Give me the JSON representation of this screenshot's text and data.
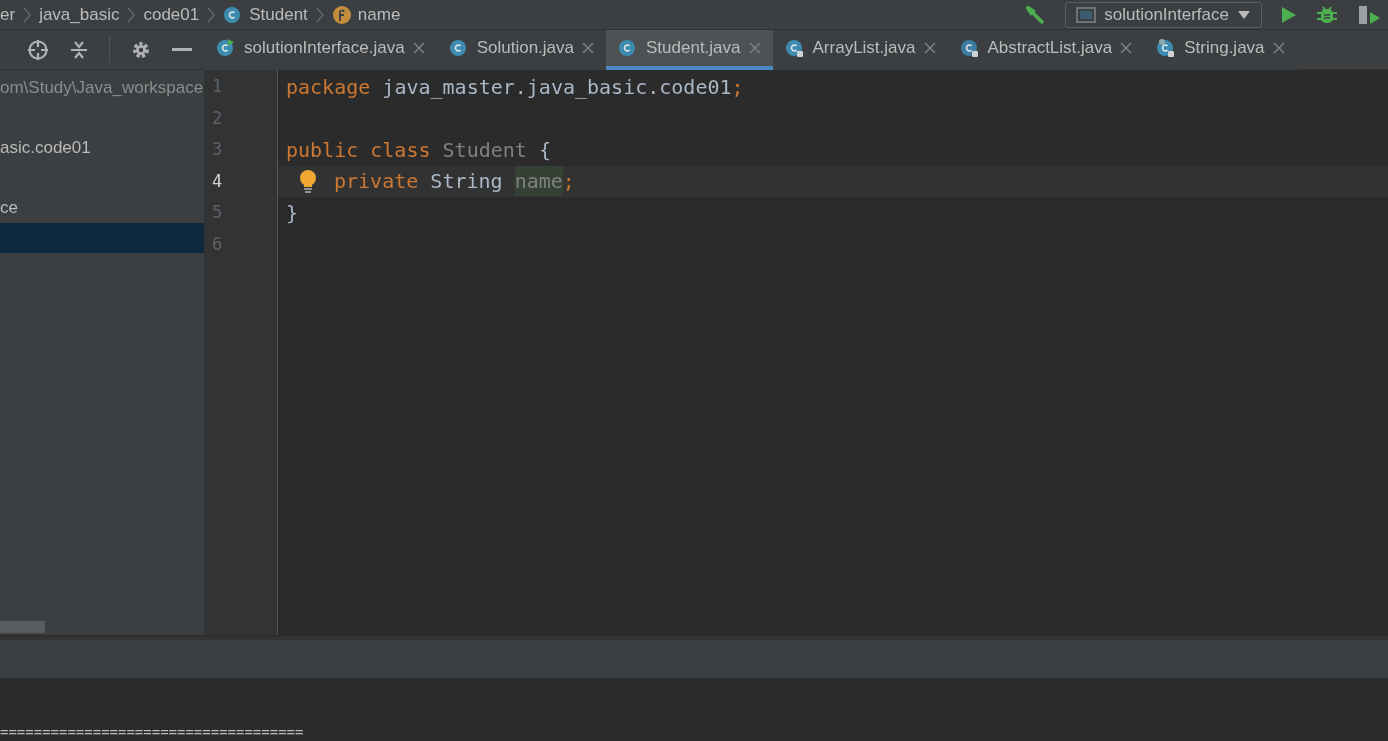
{
  "breadcrumbs": [
    {
      "label": "er",
      "kind": "folder"
    },
    {
      "label": "java_basic",
      "kind": "folder"
    },
    {
      "label": "code01",
      "kind": "folder"
    },
    {
      "label": "Student",
      "kind": "class"
    },
    {
      "label": "name",
      "kind": "field"
    }
  ],
  "run_config": {
    "label": "solutionInterface"
  },
  "tabs": [
    {
      "label": "solutionInterface.java",
      "kind": "runnable",
      "selected": false
    },
    {
      "label": "Solution.java",
      "kind": "class",
      "selected": false
    },
    {
      "label": "Student.java",
      "kind": "class",
      "selected": true
    },
    {
      "label": "ArrayList.java",
      "kind": "library",
      "selected": false
    },
    {
      "label": "AbstractList.java",
      "kind": "library-abstract",
      "selected": false
    },
    {
      "label": "String.java",
      "kind": "library-final",
      "selected": false
    }
  ],
  "project_tree": [
    {
      "label": "om\\Study\\Java_workspace",
      "muted": true,
      "selected": false
    },
    {
      "label": "asic.code01",
      "muted": false,
      "selected": false
    },
    {
      "label": "ce",
      "muted": false,
      "selected": false
    },
    {
      "selected": true
    }
  ],
  "editor": {
    "lines": [
      {
        "number": "1",
        "current": false,
        "tokens": [
          {
            "text": "package",
            "kind": "keyword"
          },
          {
            "text": " java_master.java_basic.code01",
            "kind": "plain"
          },
          {
            "text": ";",
            "kind": "keyword"
          }
        ]
      },
      {
        "number": "2",
        "current": false
      },
      {
        "number": "3",
        "current": false,
        "tokens": [
          {
            "text": "public class ",
            "kind": "keyword"
          },
          {
            "text": "Student",
            "kind": "muted"
          },
          {
            "text": " {",
            "kind": "plain"
          }
        ]
      },
      {
        "number": "4",
        "current": true,
        "bulb": true,
        "tokens": [
          {
            "text": "private",
            "kind": "keyword"
          },
          {
            "text": " String ",
            "kind": "plain"
          },
          {
            "text": "name",
            "kind": "highlight"
          },
          {
            "text": ";",
            "kind": "keyword"
          }
        ]
      },
      {
        "number": "5",
        "current": false,
        "tokens": [
          {
            "text": "}",
            "kind": "plain"
          }
        ]
      },
      {
        "number": "6",
        "current": false
      }
    ]
  },
  "console": {
    "lines": [
      "===================================="
    ]
  }
}
